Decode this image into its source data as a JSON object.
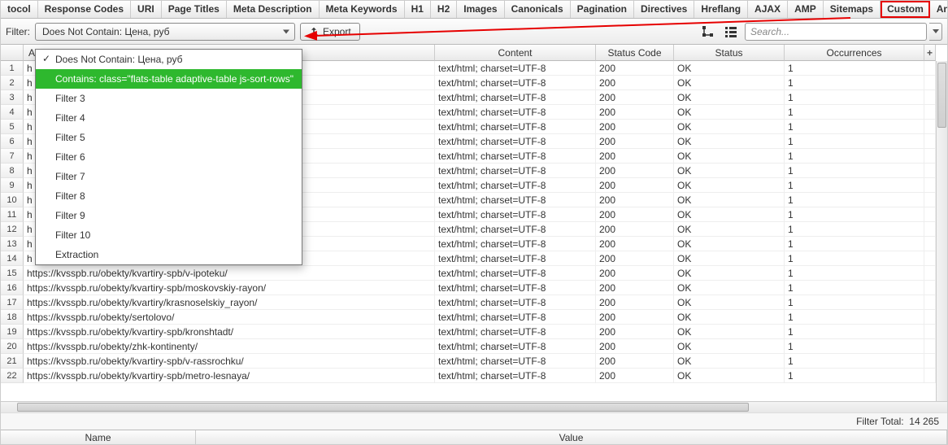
{
  "tabs": [
    "tocol",
    "Response Codes",
    "URI",
    "Page Titles",
    "Meta Description",
    "Meta Keywords",
    "H1",
    "H2",
    "Images",
    "Canonicals",
    "Pagination",
    "Directives",
    "Hreflang",
    "AJAX",
    "AMP",
    "Sitemaps",
    "Custom",
    "Analytics"
  ],
  "active_tab_index": 16,
  "toolbar": {
    "filter_label": "Filter:",
    "filter_value": "Does Not Contain: Цена, руб",
    "export_label": "Export",
    "search_placeholder": "Search..."
  },
  "dropdown": {
    "items": [
      {
        "label": "Does Not Contain: Цена, руб",
        "checked": true,
        "hover": false
      },
      {
        "label": "Contains: class=\"flats-table adaptive-table js-sort-rows\"",
        "checked": false,
        "hover": true
      },
      {
        "label": "Filter 3",
        "checked": false,
        "hover": false
      },
      {
        "label": "Filter 4",
        "checked": false,
        "hover": false
      },
      {
        "label": "Filter 5",
        "checked": false,
        "hover": false
      },
      {
        "label": "Filter 6",
        "checked": false,
        "hover": false
      },
      {
        "label": "Filter 7",
        "checked": false,
        "hover": false
      },
      {
        "label": "Filter 8",
        "checked": false,
        "hover": false
      },
      {
        "label": "Filter 9",
        "checked": false,
        "hover": false
      },
      {
        "label": "Filter 10",
        "checked": false,
        "hover": false
      },
      {
        "label": "Extraction",
        "checked": false,
        "hover": false
      }
    ]
  },
  "columns": [
    "",
    "Address",
    "Content",
    "Status Code",
    "Status",
    "Occurrences"
  ],
  "rows": [
    {
      "n": 1,
      "addr": "h",
      "content": "text/html; charset=UTF-8",
      "code": "200",
      "status": "OK",
      "occ": "1"
    },
    {
      "n": 2,
      "addr": "h",
      "content": "text/html; charset=UTF-8",
      "code": "200",
      "status": "OK",
      "occ": "1"
    },
    {
      "n": 3,
      "addr": "h",
      "content": "text/html; charset=UTF-8",
      "code": "200",
      "status": "OK",
      "occ": "1"
    },
    {
      "n": 4,
      "addr": "h",
      "content": "text/html; charset=UTF-8",
      "code": "200",
      "status": "OK",
      "occ": "1"
    },
    {
      "n": 5,
      "addr": "h                                                           ya_zhemchuzhina/",
      "content": "text/html; charset=UTF-8",
      "code": "200",
      "status": "OK",
      "occ": "1"
    },
    {
      "n": 6,
      "addr": "h",
      "content": "text/html; charset=UTF-8",
      "code": "200",
      "status": "OK",
      "occ": "1"
    },
    {
      "n": 7,
      "addr": "h",
      "content": "text/html; charset=UTF-8",
      "code": "200",
      "status": "OK",
      "occ": "1"
    },
    {
      "n": 8,
      "addr": "h",
      "content": "text/html; charset=UTF-8",
      "code": "200",
      "status": "OK",
      "occ": "1"
    },
    {
      "n": 9,
      "addr": "h",
      "content": "text/html; charset=UTF-8",
      "code": "200",
      "status": "OK",
      "occ": "1"
    },
    {
      "n": 10,
      "addr": "h                                                           aja/",
      "content": "text/html; charset=UTF-8",
      "code": "200",
      "status": "OK",
      "occ": "1"
    },
    {
      "n": 11,
      "addr": "h",
      "content": "text/html; charset=UTF-8",
      "code": "200",
      "status": "OK",
      "occ": "1"
    },
    {
      "n": 12,
      "addr": "h",
      "content": "text/html; charset=UTF-8",
      "code": "200",
      "status": "OK",
      "occ": "1"
    },
    {
      "n": 13,
      "addr": "h",
      "content": "text/html; charset=UTF-8",
      "code": "200",
      "status": "OK",
      "occ": "1"
    },
    {
      "n": 14,
      "addr": "h",
      "content": "text/html; charset=UTF-8",
      "code": "200",
      "status": "OK",
      "occ": "1"
    },
    {
      "n": 15,
      "addr": "https://kvsspb.ru/obekty/kvartiry-spb/v-ipoteku/",
      "content": "text/html; charset=UTF-8",
      "code": "200",
      "status": "OK",
      "occ": "1"
    },
    {
      "n": 16,
      "addr": "https://kvsspb.ru/obekty/kvartiry-spb/moskovskiy-rayon/",
      "content": "text/html; charset=UTF-8",
      "code": "200",
      "status": "OK",
      "occ": "1"
    },
    {
      "n": 17,
      "addr": "https://kvsspb.ru/obekty/kvartiry/krasnoselskiy_rayon/",
      "content": "text/html; charset=UTF-8",
      "code": "200",
      "status": "OK",
      "occ": "1"
    },
    {
      "n": 18,
      "addr": "https://kvsspb.ru/obekty/sertolovo/",
      "content": "text/html; charset=UTF-8",
      "code": "200",
      "status": "OK",
      "occ": "1"
    },
    {
      "n": 19,
      "addr": "https://kvsspb.ru/obekty/kvartiry-spb/kronshtadt/",
      "content": "text/html; charset=UTF-8",
      "code": "200",
      "status": "OK",
      "occ": "1"
    },
    {
      "n": 20,
      "addr": "https://kvsspb.ru/obekty/zhk-kontinenty/",
      "content": "text/html; charset=UTF-8",
      "code": "200",
      "status": "OK",
      "occ": "1"
    },
    {
      "n": 21,
      "addr": "https://kvsspb.ru/obekty/kvartiry-spb/v-rassrochku/",
      "content": "text/html; charset=UTF-8",
      "code": "200",
      "status": "OK",
      "occ": "1"
    },
    {
      "n": 22,
      "addr": "https://kvsspb.ru/obekty/kvartiry-spb/metro-lesnaya/",
      "content": "text/html; charset=UTF-8",
      "code": "200",
      "status": "OK",
      "occ": "1"
    }
  ],
  "filter_total": {
    "label": "Filter Total:",
    "value": "14 265"
  },
  "bottom_panel": {
    "name_col": "Name",
    "value_col": "Value"
  }
}
